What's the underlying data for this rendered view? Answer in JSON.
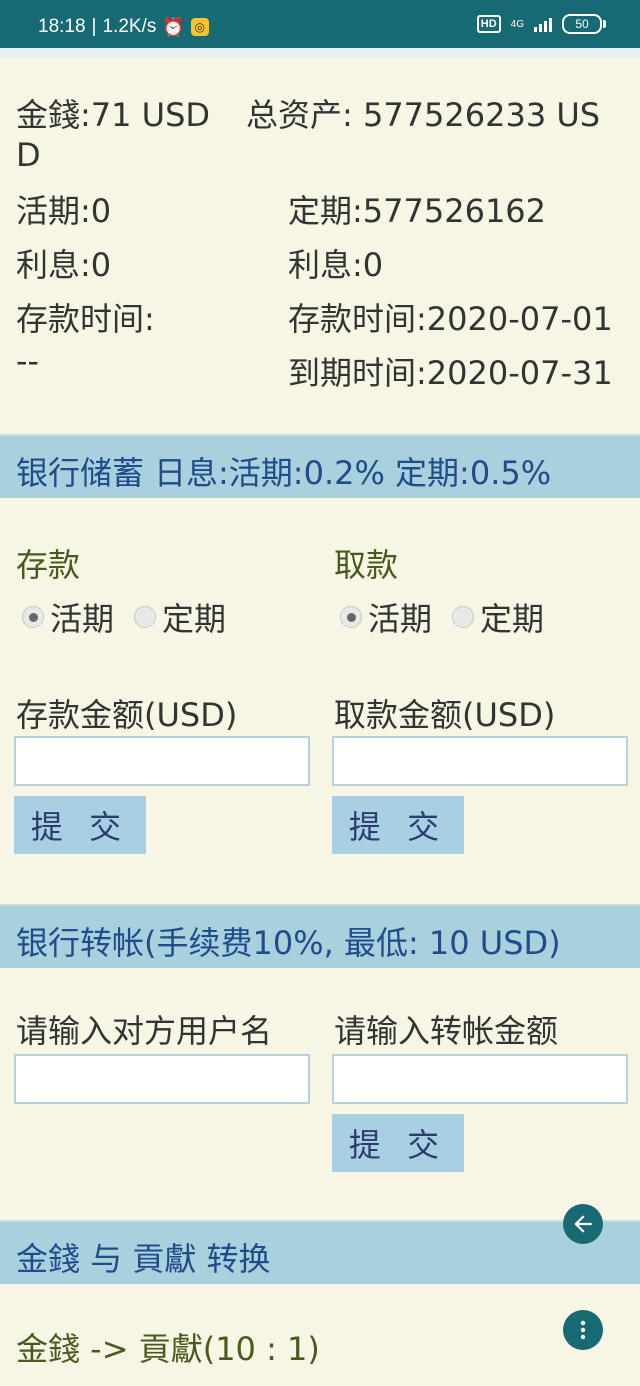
{
  "status_bar": {
    "time": "18:18",
    "network_speed": "1.2K/s",
    "hd_badge": "HD",
    "network_type": "4G",
    "battery": "50",
    "icons": [
      "alarm-icon",
      "app-notification-icon",
      "signal-icon",
      "battery-icon"
    ]
  },
  "account": {
    "money": "金錢:71 USD",
    "total_assets_line1": "总资产: 577526233 US",
    "total_assets_line2": "D",
    "demand": "活期:0",
    "fixed": "定期:577526162",
    "demand_interest": "利息:0",
    "fixed_interest": "利息:0",
    "demand_deposit_time": "存款时间:",
    "demand_deposit_time_value": "--",
    "fixed_deposit_time": "存款时间:2020-07-01",
    "fixed_due_time": "到期时间:2020-07-31"
  },
  "savings": {
    "title": "银行储蓄",
    "rate": "日息:活期:0.2% 定期:0.5%",
    "deposit": {
      "heading": "存款",
      "options": [
        "活期",
        "定期"
      ],
      "selected": "活期",
      "amount_label": "存款金额(USD)",
      "amount_value": "",
      "submit": "提 交"
    },
    "withdraw": {
      "heading": "取款",
      "options": [
        "活期",
        "定期"
      ],
      "selected": "活期",
      "amount_label": "取款金额(USD)",
      "amount_value": "",
      "submit": "提 交"
    }
  },
  "transfer": {
    "title": "银行转帐(手续费10%, 最低: 10 USD)",
    "username_label": "请输入对方用户名",
    "amount_label": "请输入转帐金额",
    "username_value": "",
    "amount_value": "",
    "submit": "提 交"
  },
  "exchange": {
    "title": "金錢 与 貢獻 转换",
    "money_to_contribution": "金錢 -> 貢獻(10 : 1)"
  },
  "colors": {
    "status_bar": "#176a73",
    "band": "#a9d0dd",
    "page_bg": "#f7f6e4",
    "band_text": "#204c8a",
    "heading_green": "#4a5a1e"
  }
}
